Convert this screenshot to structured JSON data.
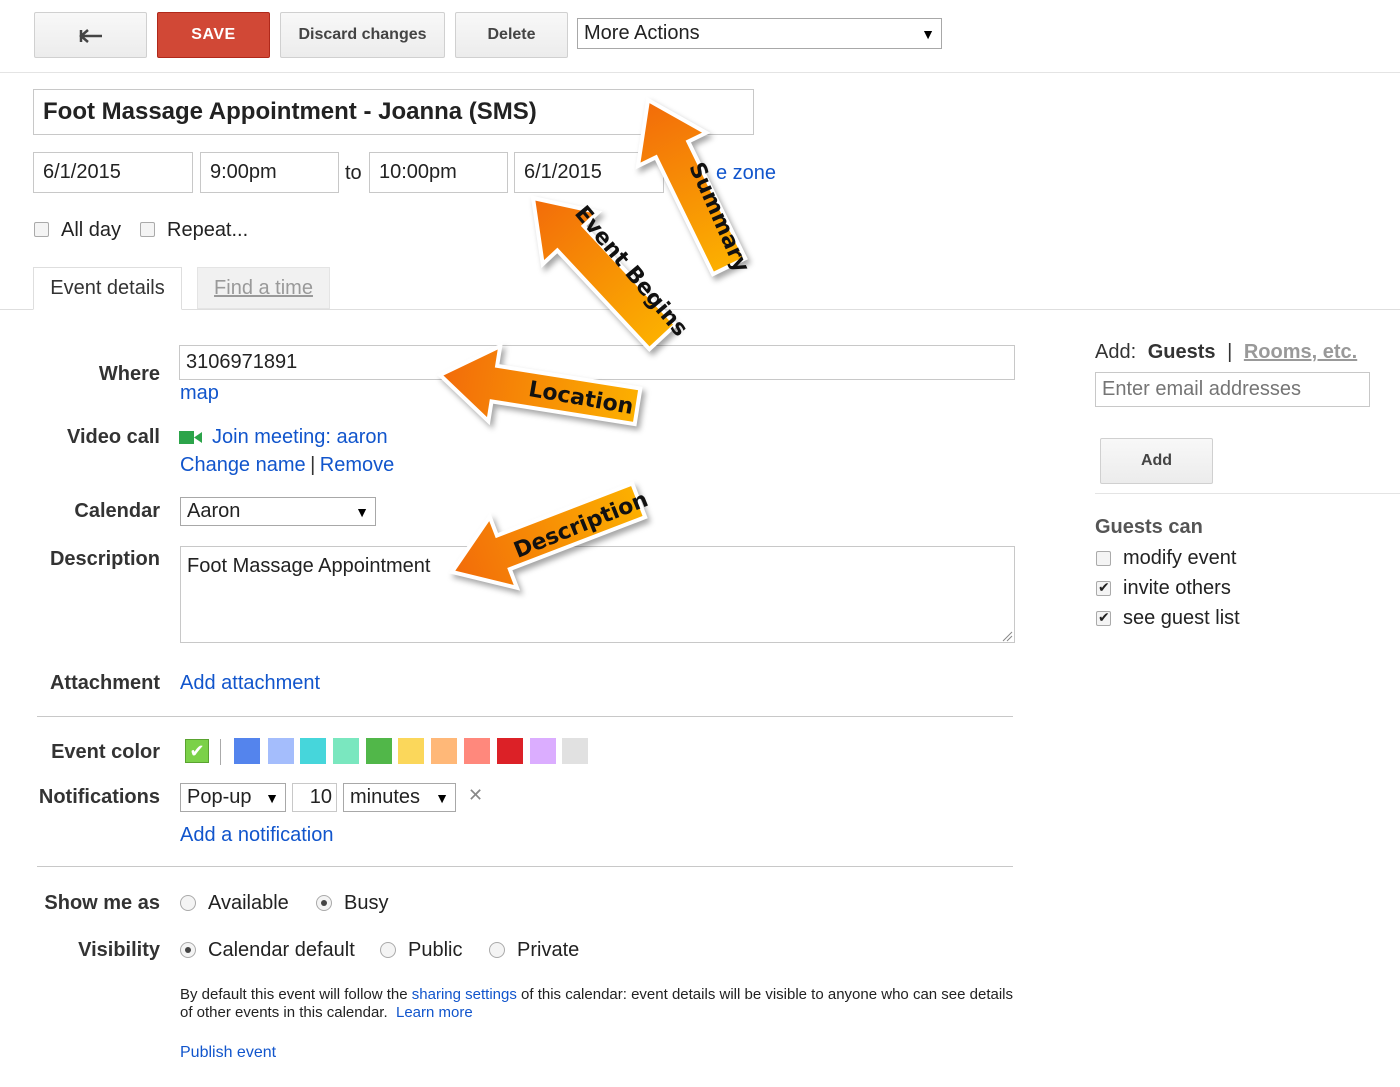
{
  "toolbar": {
    "back_label": "↞",
    "save_label": "SAVE",
    "discard_label": "Discard changes",
    "delete_label": "Delete",
    "more_actions_label": "More Actions"
  },
  "event": {
    "title": "Foot Massage Appointment - Joanna (SMS)",
    "start_date": "6/1/2015",
    "start_time": "9:00pm",
    "to_label": "to",
    "end_time": "10:00pm",
    "end_date": "6/1/2015",
    "time_zone_link": "e zone",
    "all_day_label": "All day",
    "repeat_label": "Repeat..."
  },
  "tabs": [
    {
      "label": "Event details"
    },
    {
      "label": "Find a time"
    }
  ],
  "form": {
    "where_label": "Where",
    "where_value": "3106971891",
    "map_link": "map",
    "video_call_label": "Video call",
    "join_meeting_link": "Join meeting: aaron",
    "change_name_link": "Change name",
    "separator": "|",
    "remove_link": "Remove",
    "calendar_label": "Calendar",
    "calendar_value": "Aaron",
    "description_label": "Description",
    "description_value": "Foot Massage Appointment",
    "attachment_label": "Attachment",
    "add_attachment_link": "Add attachment",
    "event_color_label": "Event color",
    "notifications_label": "Notifications",
    "notification_type": "Pop-up",
    "notification_amount": "10",
    "notification_unit": "minutes",
    "remove_notification": "✕",
    "add_notification_link": "Add a notification",
    "show_me_as_label": "Show me as",
    "available_label": "Available",
    "busy_label": "Busy",
    "visibility_label": "Visibility",
    "calendar_default_label": "Calendar default",
    "public_label": "Public",
    "private_label": "Private",
    "visibility_note_1": "By default this event will follow the",
    "sharing_settings_link": "sharing settings",
    "visibility_note_2": "of this calendar: event details will be visible to anyone who",
    "visibility_note_3": "can see details of other events in this calendar.",
    "learn_more_link": "Learn more",
    "publish_event_link": "Publish event"
  },
  "colors": {
    "swatches": [
      "#7ae7bf",
      "#5484ed",
      "#a4bdfc",
      "#46d6db",
      "#7ae7bf",
      "#51b749",
      "#fbd75b",
      "#ffb878",
      "#ff887c",
      "#dc2127",
      "#dbadff",
      "#e1e1e1"
    ],
    "selected": "#7bd148"
  },
  "guests": {
    "add_prefix": "Add:",
    "guests_tab": "Guests",
    "separator": "|",
    "rooms_tab": "Rooms, etc.",
    "email_placeholder": "Enter email addresses",
    "add_button": "Add",
    "guests_can_label": "Guests can",
    "options": [
      {
        "label": "modify event",
        "checked": false
      },
      {
        "label": "invite others",
        "checked": true
      },
      {
        "label": "see guest list",
        "checked": true
      }
    ]
  },
  "annotations": {
    "summary": "Summary",
    "event_begins": "Event Begins",
    "location": "Location",
    "description": "Description",
    "arrow_color": "#f47e0e"
  }
}
